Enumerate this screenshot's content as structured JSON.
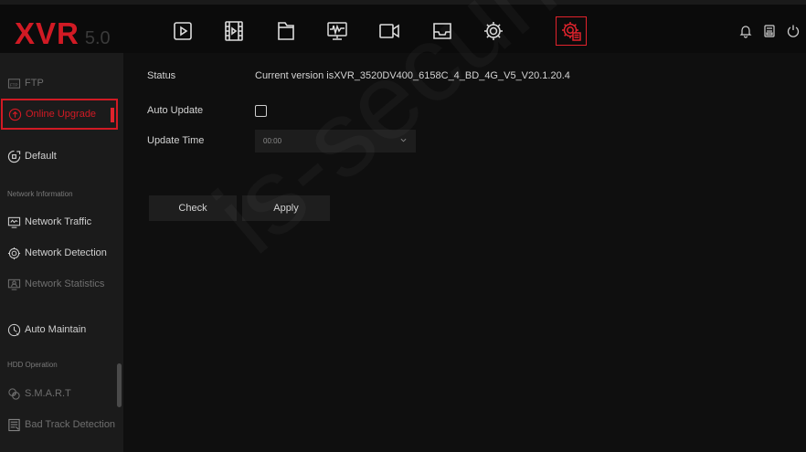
{
  "brand": {
    "name": "XVR",
    "version": "5.0"
  },
  "nav_icons": [
    "playback-icon",
    "video-clip-icon",
    "file-icon",
    "monitor-waveform-icon",
    "camera-icon",
    "tray-icon",
    "gear-icon",
    "system-settings-icon"
  ],
  "right_icons": [
    "bell-icon",
    "backup-icon",
    "power-icon"
  ],
  "sidebar": {
    "items": [
      {
        "label": "FTP",
        "icon": "ftp-icon",
        "state": "dim"
      },
      {
        "label": "Online Upgrade",
        "icon": "upgrade-icon",
        "state": "selected"
      },
      {
        "label": "Default",
        "icon": "default-icon",
        "state": "normal"
      }
    ],
    "section_network": "Network Information",
    "network_items": [
      {
        "label": "Network Traffic",
        "icon": "network-traffic-icon",
        "state": "normal"
      },
      {
        "label": "Network Detection",
        "icon": "network-detection-icon",
        "state": "normal"
      },
      {
        "label": "Network Statistics",
        "icon": "network-statistics-icon",
        "state": "dim"
      }
    ],
    "maintain_item": {
      "label": "Auto Maintain",
      "icon": "auto-maintain-icon",
      "state": "normal"
    },
    "section_hdd": "HDD Operation",
    "hdd_items": [
      {
        "label": "S.M.A.R.T",
        "icon": "smart-icon",
        "state": "dim"
      },
      {
        "label": "Bad Track Detection",
        "icon": "bad-track-icon",
        "state": "dim"
      }
    ]
  },
  "form": {
    "status_label": "Status",
    "status_value": "Current version isXVR_3520DV400_6158C_4_BD_4G_V5_V20.1.20.4",
    "auto_update_label": "Auto Update",
    "auto_update_checked": false,
    "update_time_label": "Update Time",
    "update_time_value": "00:00"
  },
  "buttons": {
    "check": "Check",
    "apply": "Apply"
  },
  "watermark": "is-security.c",
  "colors": {
    "accent": "#d11a24",
    "background": "#0f0f0f",
    "sidebar": "#1b1b1b",
    "text": "#d4d4d4"
  }
}
